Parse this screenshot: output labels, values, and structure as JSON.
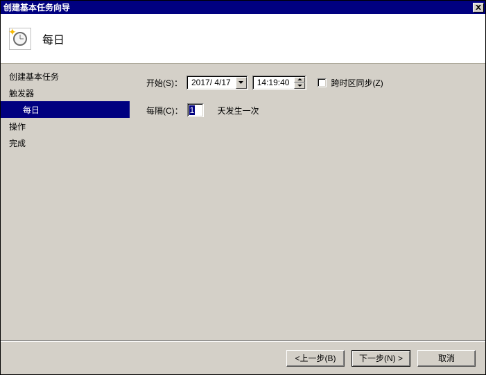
{
  "window": {
    "title": "创建基本任务向导"
  },
  "header": {
    "icon": "clock-icon",
    "title": "每日"
  },
  "sidebar": {
    "items": [
      {
        "label": "创建基本任务",
        "selected": false,
        "indent": false
      },
      {
        "label": "触发器",
        "selected": false,
        "indent": false
      },
      {
        "label": "每日",
        "selected": true,
        "indent": true
      },
      {
        "label": "操作",
        "selected": false,
        "indent": false
      },
      {
        "label": "完成",
        "selected": false,
        "indent": false
      }
    ]
  },
  "form": {
    "start_label": "开始(S)：",
    "date_value": "2017/ 4/17",
    "time_value": "14:19:40",
    "sync_tz_label": "跨时区同步(Z)",
    "sync_tz_checked": false,
    "recur_label": "每隔(C)：",
    "recur_value": "1",
    "recur_suffix": "天发生一次"
  },
  "buttons": {
    "back": "<上一步(B)",
    "next": "下一步(N) >",
    "cancel": "取消"
  }
}
